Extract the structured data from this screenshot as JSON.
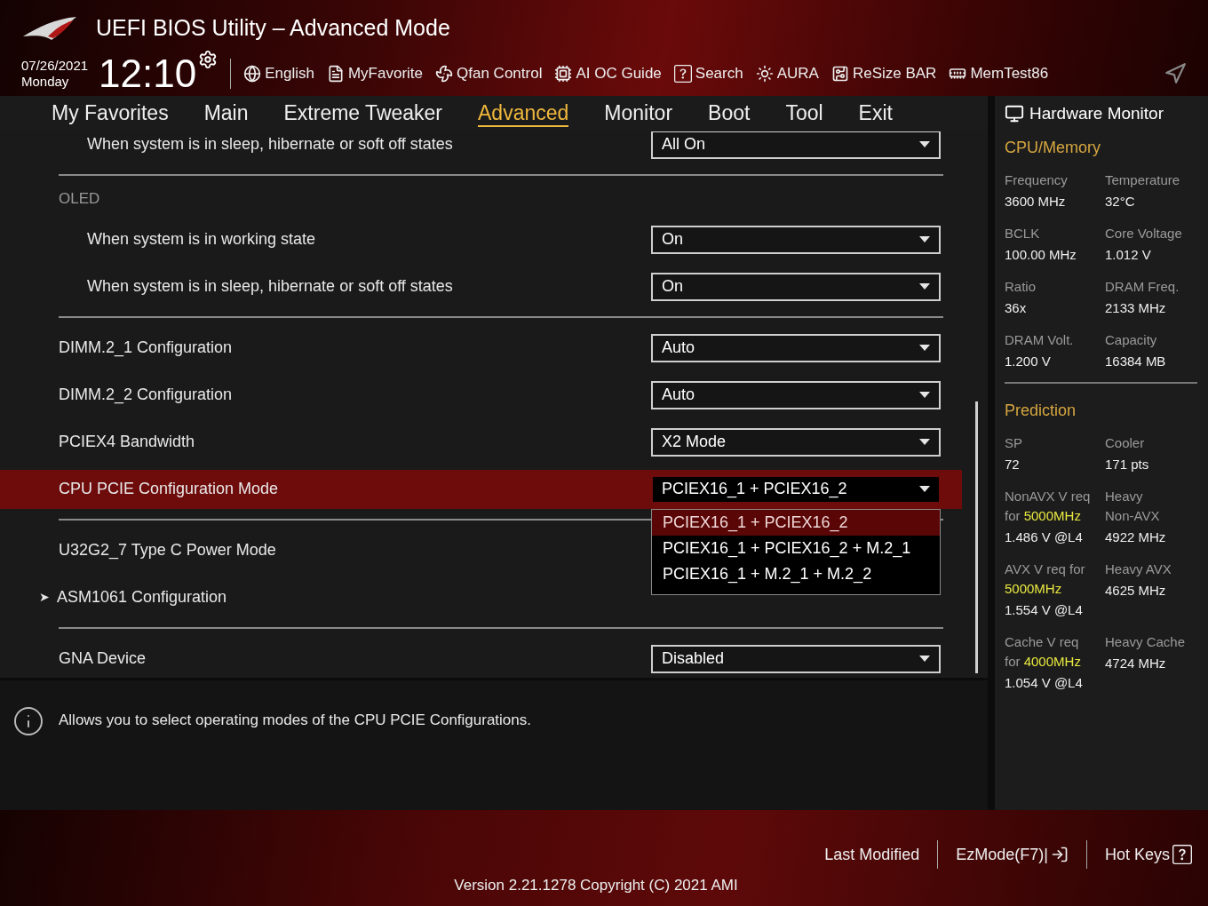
{
  "header": {
    "title": "UEFI BIOS Utility – Advanced Mode",
    "date": "07/26/2021",
    "day": "Monday",
    "time": "12:10",
    "toolbar": [
      {
        "label": "English"
      },
      {
        "label": "MyFavorite"
      },
      {
        "label": "Qfan Control"
      },
      {
        "label": "AI OC Guide"
      },
      {
        "label": "Search"
      },
      {
        "label": "AURA"
      },
      {
        "label": "ReSize BAR"
      },
      {
        "label": "MemTest86"
      }
    ]
  },
  "tabs": [
    {
      "label": "My Favorites",
      "selected": false
    },
    {
      "label": "Main",
      "selected": false
    },
    {
      "label": "Extreme Tweaker",
      "selected": false
    },
    {
      "label": "Advanced",
      "selected": true
    },
    {
      "label": "Monitor",
      "selected": false
    },
    {
      "label": "Boot",
      "selected": false
    },
    {
      "label": "Tool",
      "selected": false
    },
    {
      "label": "Exit",
      "selected": false
    }
  ],
  "settings": [
    {
      "kind": "group",
      "children": [
        {
          "kind": "setting",
          "label": "When system is in sleep, hibernate or soft off states",
          "value": "All On",
          "selected": false
        }
      ]
    },
    {
      "kind": "divider"
    },
    {
      "kind": "group",
      "label": "OLED",
      "children": [
        {
          "kind": "setting",
          "label": "When system is in working state",
          "value": "On",
          "selected": false
        },
        {
          "kind": "setting",
          "label": "When system is in sleep, hibernate or soft off states",
          "value": "On",
          "selected": false
        }
      ]
    },
    {
      "kind": "divider"
    },
    {
      "kind": "setting",
      "label": "DIMM.2_1 Configuration",
      "value": "Auto",
      "selected": false
    },
    {
      "kind": "setting",
      "label": "DIMM.2_2 Configuration",
      "value": "Auto",
      "selected": false
    },
    {
      "kind": "setting",
      "label": "PCIEX4 Bandwidth",
      "value": "X2 Mode",
      "selected": false
    },
    {
      "kind": "setting",
      "label": "CPU PCIE Configuration Mode",
      "value": "PCIEX16_1 + PCIEX16_2",
      "selected": true,
      "options": [
        {
          "label": "PCIEX16_1 + PCIEX16_2",
          "selected": true
        },
        {
          "label": "PCIEX16_1 + PCIEX16_2 + M.2_1",
          "selected": false
        },
        {
          "label": "PCIEX16_1 + M.2_1 + M.2_2",
          "selected": false
        }
      ]
    },
    {
      "kind": "divider"
    },
    {
      "kind": "setting",
      "label": "U32G2_7 Type C Power Mode",
      "selected": false
    },
    {
      "kind": "submenu",
      "label": "ASM1061 Configuration",
      "marker": "➤"
    },
    {
      "kind": "divider"
    },
    {
      "kind": "setting",
      "label": "GNA Device",
      "value": "Disabled",
      "selected": false
    }
  ],
  "help_text": "Allows you to select operating modes of the CPU PCIE Configurations.",
  "hardware_monitor": {
    "title": "Hardware Monitor",
    "sections": [
      {
        "title": "CPU/Memory",
        "items": [
          {
            "label": "Frequency",
            "value": "3600 MHz"
          },
          {
            "label": "Temperature",
            "value": "32°C"
          },
          {
            "label": "BCLK",
            "value": "100.00 MHz"
          },
          {
            "label": "Core Voltage",
            "value": "1.012 V"
          },
          {
            "label": "Ratio",
            "value": "36x"
          },
          {
            "label": "DRAM Freq.",
            "value": "2133 MHz"
          },
          {
            "label": "DRAM Volt.",
            "value": "1.200 V"
          },
          {
            "label": "Capacity",
            "value": "16384 MB"
          }
        ]
      },
      {
        "title": "Prediction",
        "items": [
          {
            "label": "SP",
            "value": "72"
          },
          {
            "label": "Cooler",
            "value": "171 pts"
          },
          {
            "label": "NonAVX V req\nfor **5000MHz**",
            "value": "1.486 V @L4"
          },
          {
            "label": "Heavy\nNon-AVX",
            "value": "4922 MHz"
          },
          {
            "label": "AVX V req    for\n**5000MHz**",
            "value": "1.554 V @L4"
          },
          {
            "label": "Heavy AVX",
            "value": "4625 MHz"
          },
          {
            "label": "Cache V req\nfor **4000MHz**",
            "value": "1.054 V @L4"
          },
          {
            "label": "Heavy Cache",
            "value": "4724 MHz"
          }
        ]
      }
    ]
  },
  "footer": {
    "buttons": [
      "Last Modified",
      "EzMode(F7)|",
      "Hot Keys"
    ],
    "version": "Version 2.21.1278 Copyright (C) 2021 AMI"
  }
}
